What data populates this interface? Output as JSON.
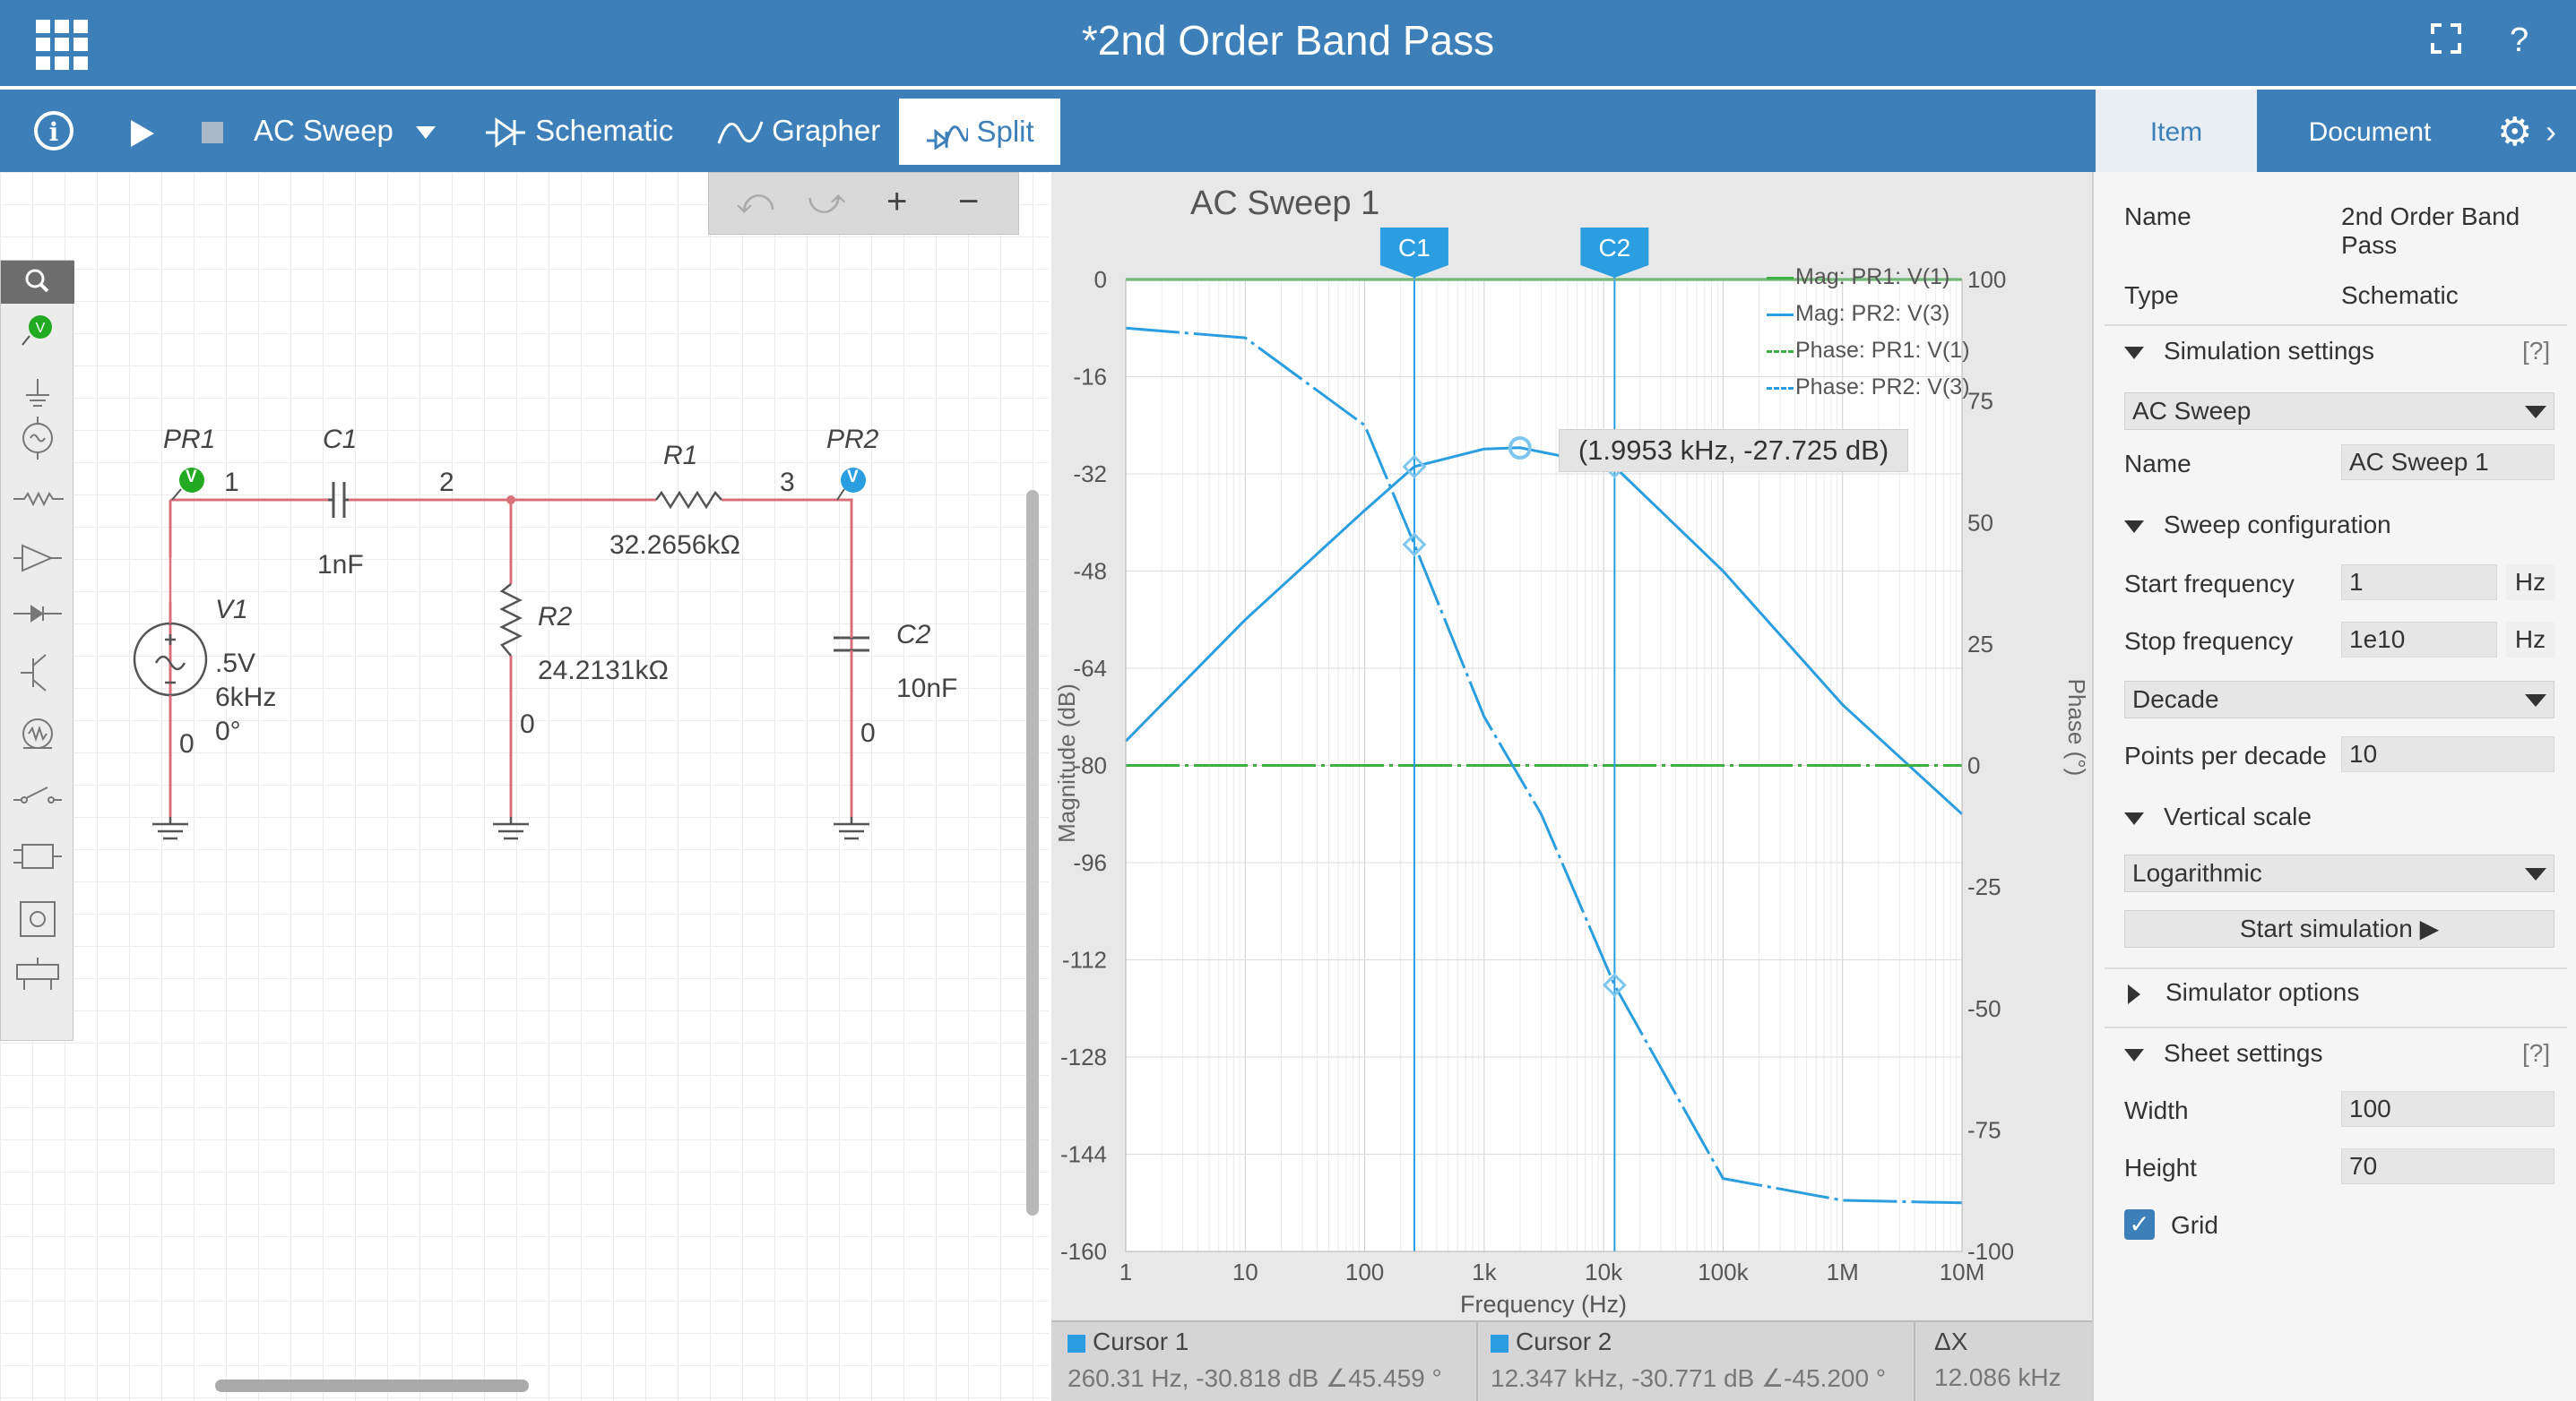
{
  "app": {
    "title": "*2nd Order Band Pass",
    "fullscreen_icon": "fullscreen-icon",
    "help_label": "?"
  },
  "toolbar": {
    "info_label": "i",
    "simulation_mode": "AC Sweep",
    "tab_schematic": "Schematic",
    "tab_grapher": "Grapher",
    "tab_split": "Split"
  },
  "right_tabs": {
    "item": "Item",
    "document": "Document"
  },
  "schematic": {
    "undo_label": "⤺",
    "redo_label": "⤻",
    "zoom_in_label": "+",
    "zoom_out_label": "−",
    "components": {
      "pr1": "PR1",
      "pr2": "PR2",
      "c1": "C1",
      "c1_value": "1nF",
      "r1": "R1",
      "r1_value": "32.2656kΩ",
      "r2": "R2",
      "r2_value": "24.2131kΩ",
      "c2": "C2",
      "c2_value": "10nF",
      "v1": "V1",
      "v1_amp": ".5V",
      "v1_freq": "6kHz",
      "v1_phase": "0°"
    },
    "nodes": [
      "1",
      "2",
      "3",
      "0",
      "0",
      "0",
      "0"
    ],
    "probe_letter": "V"
  },
  "graph": {
    "title": "AC Sweep 1",
    "cursor1_label": "C1",
    "cursor2_label": "C2",
    "tooltip": "(1.9953 kHz, -27.725 dB)",
    "left_axis_label": "Magnitude (dB)",
    "right_axis_label": "Phase (°)",
    "x_axis_label": "Frequency (Hz)",
    "legend": [
      "Mag: PR1: V(1)",
      "Mag: PR2: V(3)",
      "Phase: PR1: V(1)",
      "Phase: PR2: V(3)"
    ],
    "cursor_bar": {
      "c1_name": "Cursor 1",
      "c1_value": "260.31 Hz, -30.818 dB ∠45.459 °",
      "c2_name": "Cursor 2",
      "c2_value": "12.347 kHz, -30.771 dB ∠-45.200 °",
      "dx_name": "ΔX",
      "dx_value": "12.086 kHz"
    }
  },
  "chart_data": {
    "type": "line",
    "title": "AC Sweep 1",
    "xlabel": "Frequency (Hz)",
    "ylabel": "Magnitude (dB)",
    "y2label": "Phase (°)",
    "x_scale": "log",
    "xlim": [
      1,
      10000000
    ],
    "ylim": [
      -160,
      0
    ],
    "y2lim": [
      -100,
      100
    ],
    "x_ticks": [
      "1",
      "10",
      "100",
      "1k",
      "10k",
      "100k",
      "1M",
      "10M"
    ],
    "y_ticks": [
      "0",
      "-16",
      "-32",
      "-48",
      "-64",
      "-80",
      "-96",
      "-112",
      "-128",
      "-144",
      "-160"
    ],
    "y2_ticks": [
      "100",
      "75",
      "50",
      "25",
      "0",
      "-25",
      "-50",
      "-75",
      "-100"
    ],
    "grid": true,
    "legend_position": "top-right",
    "series": [
      {
        "name": "Mag: PR1: V(1)",
        "axis": "left",
        "color": "#3cb043",
        "x": [
          1,
          10,
          100,
          1000,
          10000,
          100000,
          1000000,
          10000000
        ],
        "y": [
          0,
          0,
          0,
          0,
          0,
          0,
          0,
          0
        ]
      },
      {
        "name": "Mag: PR2: V(3)",
        "axis": "left",
        "color": "#2a9ee0",
        "x": [
          1,
          10,
          100,
          260.31,
          1000,
          1995.3,
          12347,
          100000,
          1000000,
          10000000
        ],
        "y": [
          -76,
          -56,
          -38,
          -30.8,
          -27.9,
          -27.7,
          -30.8,
          -48,
          -70,
          -88
        ]
      },
      {
        "name": "Phase: PR1: V(1)",
        "axis": "right",
        "color": "#3cb043",
        "x": [
          1,
          10,
          100,
          1000,
          10000,
          100000,
          1000000,
          10000000
        ],
        "y": [
          0,
          0,
          0,
          0,
          0,
          0,
          0,
          0
        ]
      },
      {
        "name": "Phase: PR2: V(3)",
        "axis": "right",
        "color": "#2a9ee0",
        "x": [
          1,
          10,
          100,
          260.31,
          1000,
          3000,
          12347,
          100000,
          1000000,
          10000000
        ],
        "y": [
          90,
          88,
          70,
          45.5,
          10,
          -10,
          -45.2,
          -85,
          -89.5,
          -90
        ]
      }
    ],
    "cursors": [
      {
        "label": "C1",
        "x": 260.31
      },
      {
        "label": "C2",
        "x": 12347
      }
    ]
  },
  "properties": {
    "name_label": "Name",
    "name_value": "2nd Order Band Pass",
    "type_label": "Type",
    "type_value": "Schematic",
    "simulation_settings": "Simulation settings",
    "help": "[?]",
    "sim_type": "AC Sweep",
    "sim_name_label": "Name",
    "sim_name_value": "AC Sweep 1",
    "sweep_configuration": "Sweep configuration",
    "start_freq_label": "Start frequency",
    "start_freq_value": "1",
    "stop_freq_label": "Stop frequency",
    "stop_freq_value": "1e10",
    "unit_hz": "Hz",
    "sweep_type": "Decade",
    "points_label": "Points per decade",
    "points_value": "10",
    "vertical_scale": "Vertical scale",
    "vertical_scale_value": "Logarithmic",
    "start_simulation": "Start simulation ▶",
    "simulator_options": "Simulator options",
    "sheet_settings": "Sheet settings",
    "width_label": "Width",
    "width_value": "100",
    "height_label": "Height",
    "height_value": "70",
    "grid_label": "Grid",
    "grid_checked": true
  },
  "colors": {
    "brand": "#3d7fb8",
    "trace_blue": "#2a9ee0",
    "trace_green": "#3cb043",
    "wire": "#d9707a"
  }
}
